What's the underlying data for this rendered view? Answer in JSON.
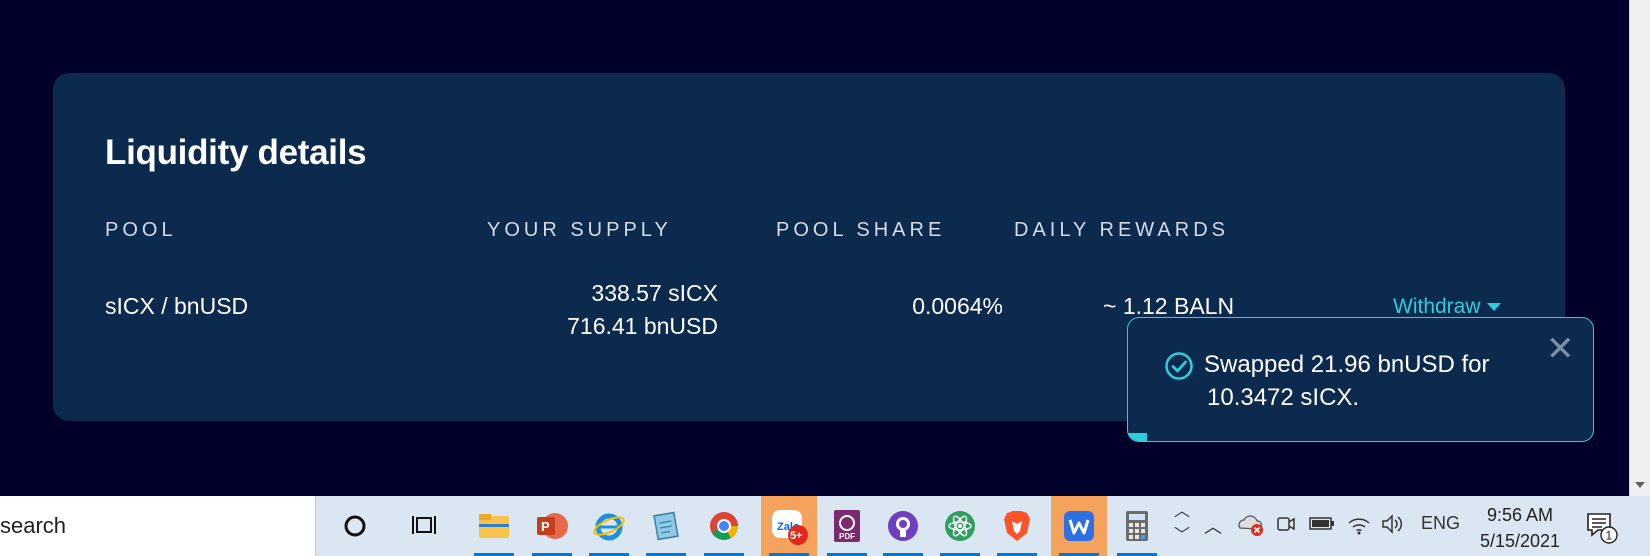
{
  "card": {
    "title": "Liquidity details",
    "columns": {
      "pool": "POOL",
      "supply": "YOUR SUPPLY",
      "share": "POOL SHARE",
      "rewards": "DAILY REWARDS"
    },
    "row": {
      "pool": "sICX / bnUSD",
      "supply_line1": "338.57 sICX",
      "supply_line2": "716.41 bnUSD",
      "share": "0.0064%",
      "rewards": "~ 1.12 BALN",
      "withdraw": "Withdraw"
    }
  },
  "toast": {
    "line1": "Swapped 21.96 bnUSD for",
    "line2": "10.3472 sICX.",
    "close": "✕",
    "progress_fraction": 0.04
  },
  "taskbar": {
    "search_text": "search",
    "language": "ENG",
    "time": "9:56 AM",
    "date": "5/15/2021",
    "notification_count": "1",
    "zalo_badge": "5+",
    "zalo_label": "Zalo",
    "pdf_label": "PDF"
  },
  "colors": {
    "background": "#01002a",
    "card": "#0c2a4d",
    "accent": "#2fccdc",
    "taskbar": "#dbe6f3"
  }
}
